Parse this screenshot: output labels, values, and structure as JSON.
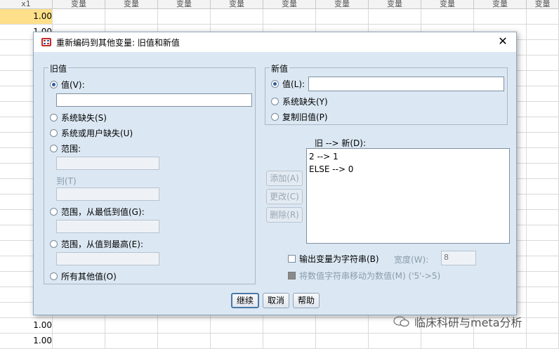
{
  "spreadsheet": {
    "first_col_header": "x1",
    "col_header": "变量",
    "visible_values": [
      "1.00",
      "1.00",
      "1.00",
      "1.00"
    ]
  },
  "dialog": {
    "title": "重新编码到其他变量: 旧值和新值",
    "old_value": {
      "legend": "旧值",
      "value_label": "值(V):",
      "value_input": "",
      "system_missing": "系统缺失(S)",
      "system_or_user_missing": "系统或用户缺失(U)",
      "range": "范围:",
      "to_label": "到(T)",
      "range_lowest": "范围，从最低到值(G):",
      "range_highest": "范围，从值到最高(E):",
      "all_other": "所有其他值(O)"
    },
    "new_value": {
      "legend": "新值",
      "value_label": "值(L):",
      "value_input": "",
      "system_missing": "系统缺失(Y)",
      "copy_old": "复制旧值(P)"
    },
    "mapping": {
      "label": "旧 --> 新(D):",
      "items": [
        "2 --> 1",
        "ELSE --> 0"
      ]
    },
    "buttons": {
      "add": "添加(A)",
      "change": "更改(C)",
      "remove": "删除(R)",
      "continue": "继续",
      "cancel": "取消",
      "help": "帮助"
    },
    "output_string": "输出变量为字符串(B)",
    "width_label": "宽度(W):",
    "width_value": "8",
    "convert_numeric": "将数值字符串移动为数值(M) ('5'->5)"
  },
  "watermark": "临床科研与meta分析"
}
